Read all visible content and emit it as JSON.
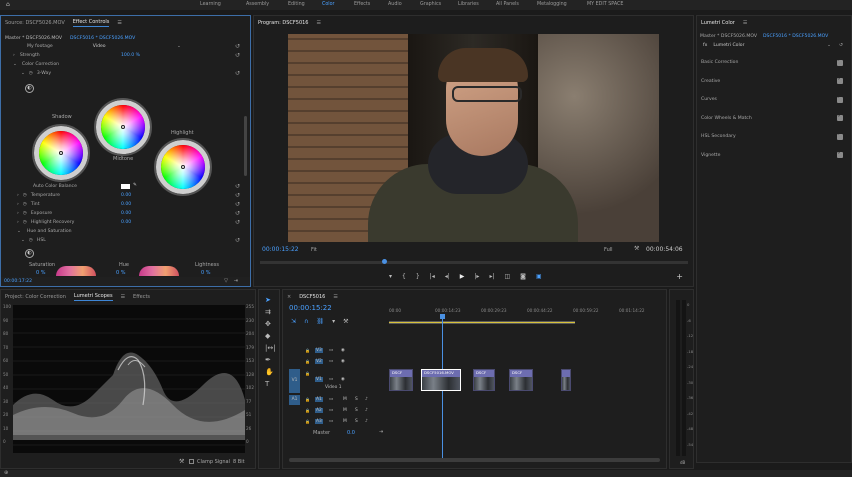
{
  "menu": {
    "items": [
      "Learning",
      "Assembly",
      "Editing",
      "Color",
      "Effects",
      "Audio",
      "Graphics",
      "Libraries",
      "All Panels",
      "Metalogging",
      "MY EDIT SPACE"
    ],
    "active": "Color"
  },
  "effect_controls": {
    "tab_source": "Source: DSCF5026.MOV",
    "tab_effect": "Effect Controls",
    "master_clip": "Master * DSCF5026.MOV",
    "sequence_clip": "DSCF5016 * DSCF5026.MOV",
    "my_footage": "My footage",
    "video_label": "Video",
    "strength_label": "Strength",
    "strength_value": "100.0 %",
    "color_correction": "Color Correction",
    "way_label": "3-Way",
    "shadow": "Shadow",
    "midtone": "Midtone",
    "highlight": "Highlight",
    "auto_color_balance": "Auto Color Balance",
    "temperature_label": "Temperature",
    "temperature_value": "0.00",
    "tint_label": "Tint",
    "tint_value": "0.00",
    "exposure_label": "Exposure",
    "exposure_value": "0.00",
    "highlight_recovery_label": "Highlight Recovery",
    "highlight_recovery_value": "0.00",
    "hue_saturation": "Hue and Saturation",
    "hsl_label": "HSL",
    "saturation": "Saturation",
    "saturation_value": "0 %",
    "hue": "Hue",
    "hue_value": "0 %",
    "lightness": "Lightness",
    "lightness_value": "0 %",
    "timecode": "00:00:17:22"
  },
  "program": {
    "title": "Program: DSCF5016",
    "timecode_left": "00:00:15:22",
    "fit": "Fit",
    "full": "Full",
    "timecode_right": "00:00:54:06"
  },
  "lumetri_color": {
    "title": "Lumetri Color",
    "master_clip": "Master * DSCF5026.MOV",
    "sequence_clip": "DSCF5016 * DSCF5026.MOV",
    "fx_label": "fx",
    "effect_name": "Lumetri Color",
    "sections": [
      "Basic Correction",
      "Creative",
      "Curves",
      "Color Wheels & Match",
      "HSL Secondary",
      "Vignette"
    ]
  },
  "scopes": {
    "tab_project": "Project: Color Correction",
    "tab_lumetri": "Lumetri Scopes",
    "tab_effects": "Effects",
    "left_scale": [
      "100",
      "90",
      "80",
      "70",
      "60",
      "50",
      "40",
      "30",
      "20",
      "10",
      "0"
    ],
    "right_scale": [
      "255",
      "230",
      "204",
      "179",
      "153",
      "128",
      "102",
      "77",
      "51",
      "26",
      "0"
    ],
    "clamp_signal": "Clamp Signal",
    "bit_depth": "8 Bit"
  },
  "timeline": {
    "tab": "DSCF5016",
    "timecode": "00:00:15:22",
    "ruler": [
      "00:00",
      "00:00:14:23",
      "00:00:29:23",
      "00:00:44:22",
      "00:00:59:22",
      "00:01:14:22"
    ],
    "video_tracks": [
      "V3",
      "V2",
      "V1"
    ],
    "audio_tracks": [
      "A1",
      "A2",
      "A3"
    ],
    "source_patch_v": "V1",
    "source_patch_a": "A1",
    "video_track_name": "Video 1",
    "master_label": "Master",
    "master_value": "0.0",
    "clips": [
      "DSCF",
      "DSCF5016.MOV",
      "DSCF",
      "DSCF",
      ""
    ]
  },
  "meter": {
    "scale": [
      "0",
      "-6",
      "-12",
      "-18",
      "-24",
      "-30",
      "-36",
      "-42",
      "-48",
      "-54"
    ],
    "unit": "dB"
  }
}
